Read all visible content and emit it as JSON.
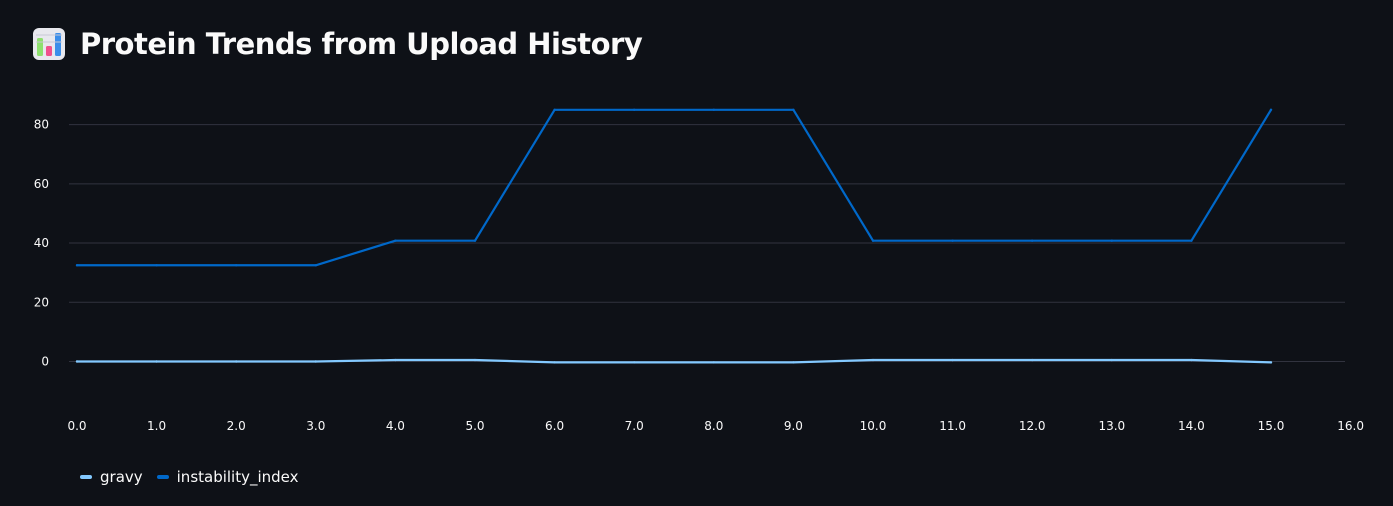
{
  "header": {
    "icon": "bar-chart-icon",
    "title": "Protein Trends from Upload History"
  },
  "colors": {
    "background": "#0e1117",
    "grid": "#31333f",
    "text": "#fafafa",
    "gravy": "#83c9ff",
    "instability_index": "#0068c9"
  },
  "chart_data": {
    "type": "line",
    "x": [
      0,
      1,
      2,
      3,
      4,
      5,
      6,
      7,
      8,
      9,
      10,
      11,
      12,
      13,
      14,
      15
    ],
    "xlim": [
      0,
      16
    ],
    "x_ticks": [
      "0.0",
      "1.0",
      "2.0",
      "3.0",
      "4.0",
      "5.0",
      "6.0",
      "7.0",
      "8.0",
      "9.0",
      "10.0",
      "11.0",
      "12.0",
      "13.0",
      "14.0",
      "15.0",
      "16.0"
    ],
    "ylim": [
      -13,
      90
    ],
    "y_ticks": [
      0,
      20,
      40,
      60,
      80
    ],
    "grid": "horizontal",
    "legend_position": "bottom-left",
    "series": [
      {
        "name": "gravy",
        "color": "#83c9ff",
        "values": [
          0,
          0,
          0,
          0,
          0.5,
          0.5,
          -0.3,
          -0.3,
          -0.3,
          -0.3,
          0.5,
          0.5,
          0.5,
          0.5,
          0.5,
          -0.3
        ]
      },
      {
        "name": "instability_index",
        "color": "#0068c9",
        "values": [
          32.5,
          32.5,
          32.5,
          32.5,
          40.8,
          40.8,
          85,
          85,
          85,
          85,
          40.8,
          40.8,
          40.8,
          40.8,
          40.8,
          85
        ]
      }
    ]
  }
}
